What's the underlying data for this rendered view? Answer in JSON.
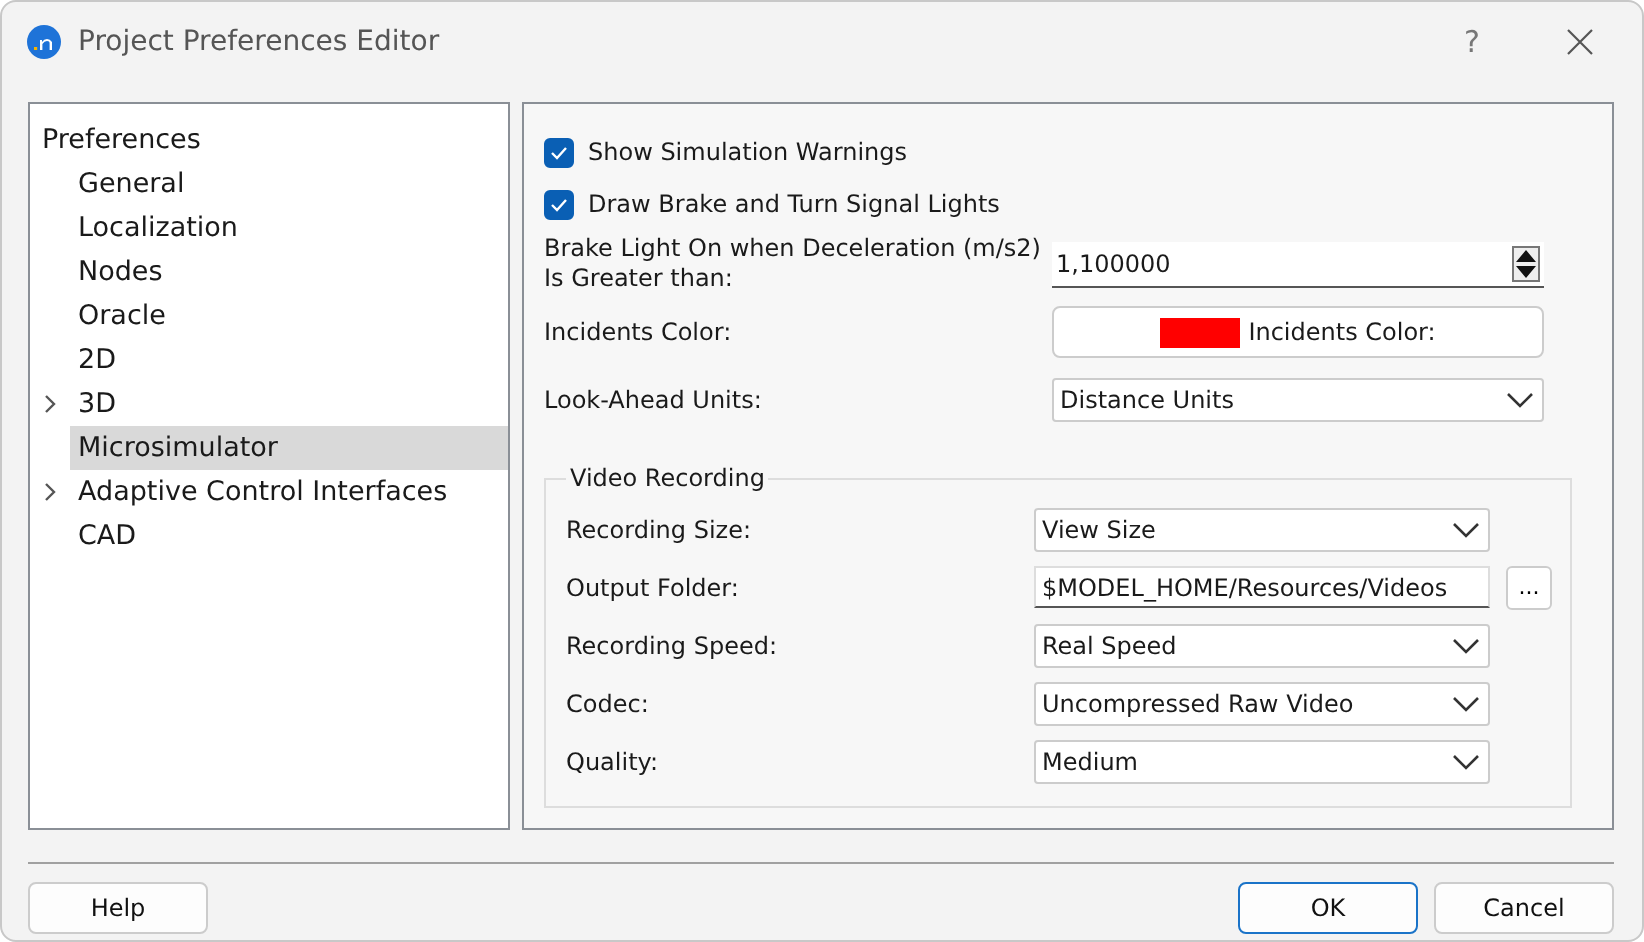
{
  "window": {
    "title": "Project Preferences Editor",
    "help": "?"
  },
  "tree": {
    "title": "Preferences",
    "items": [
      {
        "label": "General",
        "kind": "leaf",
        "selected": false
      },
      {
        "label": "Localization",
        "kind": "leaf",
        "selected": false
      },
      {
        "label": "Nodes",
        "kind": "leaf",
        "selected": false
      },
      {
        "label": "Oracle",
        "kind": "leaf",
        "selected": false
      },
      {
        "label": "2D",
        "kind": "leaf",
        "selected": false
      },
      {
        "label": "3D",
        "kind": "branch",
        "selected": false
      },
      {
        "label": "Microsimulator",
        "kind": "leaf",
        "selected": true
      },
      {
        "label": "Adaptive Control Interfaces",
        "kind": "branch",
        "selected": false
      },
      {
        "label": "CAD",
        "kind": "leaf",
        "selected": false
      }
    ]
  },
  "checkboxes": [
    {
      "label": "Show Simulation Warnings",
      "checked": true
    },
    {
      "label": "Draw Brake and Turn Signal Lights",
      "checked": true
    }
  ],
  "settings": [
    {
      "kind": "spinner",
      "label": "Brake Light On when Deceleration (m/s2) Is Greater than:",
      "value": "1,100000"
    },
    {
      "kind": "color",
      "label": "Incidents Color:",
      "value": "Incidents Color:",
      "color": "#ff0000"
    },
    {
      "kind": "dropdown",
      "label": "Look-Ahead Units:",
      "value": "Distance Units"
    }
  ],
  "video": {
    "title": "Video Recording",
    "rows": [
      {
        "kind": "dropdown",
        "label": "Recording Size:",
        "value": "View Size"
      },
      {
        "kind": "path",
        "label": "Output Folder:",
        "value": "$MODEL_HOME/Resources/Videos",
        "browse": "..."
      },
      {
        "kind": "dropdown",
        "label": "Recording Speed:",
        "value": "Real Speed"
      },
      {
        "kind": "dropdown",
        "label": "Codec:",
        "value": "Uncompressed Raw Video"
      },
      {
        "kind": "dropdown",
        "label": "Quality:",
        "value": "Medium"
      }
    ]
  },
  "buttons": [
    {
      "label": "Help",
      "kind": "left",
      "default": false
    },
    {
      "label": "OK",
      "kind": "right",
      "default": true
    },
    {
      "label": "Cancel",
      "kind": "right",
      "default": false
    }
  ]
}
